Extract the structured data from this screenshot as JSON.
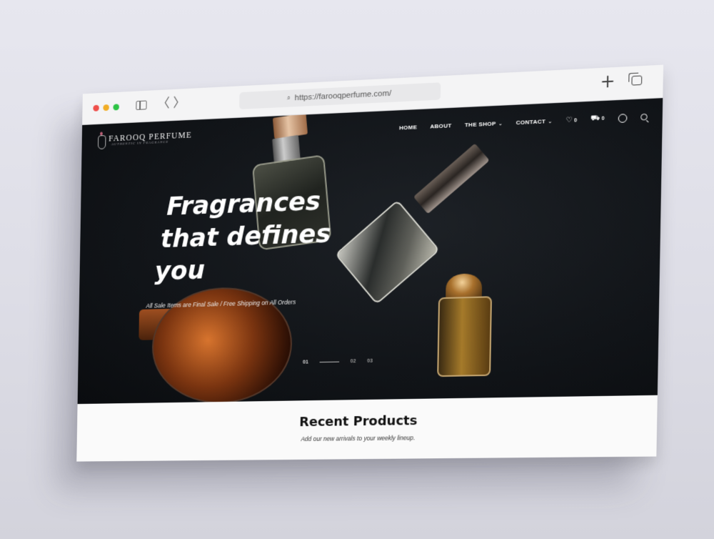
{
  "browser": {
    "url": "https://farooqperfume.com/",
    "new_tab_glyph": "+",
    "back_glyph": "〈",
    "forward_glyph": "〉",
    "lock_glyph": "🔍"
  },
  "site": {
    "logo_name": "FAROOQ PERFUME",
    "logo_tagline": "AUTHENTIC IN FRAGRANCE"
  },
  "nav": {
    "items": [
      "HOME",
      "ABOUT",
      "THE SHOP",
      "CONTACT"
    ],
    "chevron": "⌄",
    "wishlist_icon": "♡",
    "wishlist_count": "0",
    "cart_icon": "🛒",
    "cart_count": "0"
  },
  "hero": {
    "headline_1": "Fragrances",
    "headline_2": "that defines",
    "headline_3": "you",
    "subline": "All Sale Items are Final Sale / Free Shipping on All Orders",
    "slides": [
      "01",
      "02",
      "03"
    ]
  },
  "products": {
    "title": "Recent Products",
    "subtitle": "Add our new arrivals to your weekly lineup."
  },
  "colors": {
    "hero_bg": "#111418",
    "accent_red": "#ef4f4a",
    "accent_yellow": "#f1ad26",
    "accent_green": "#2dc345"
  }
}
